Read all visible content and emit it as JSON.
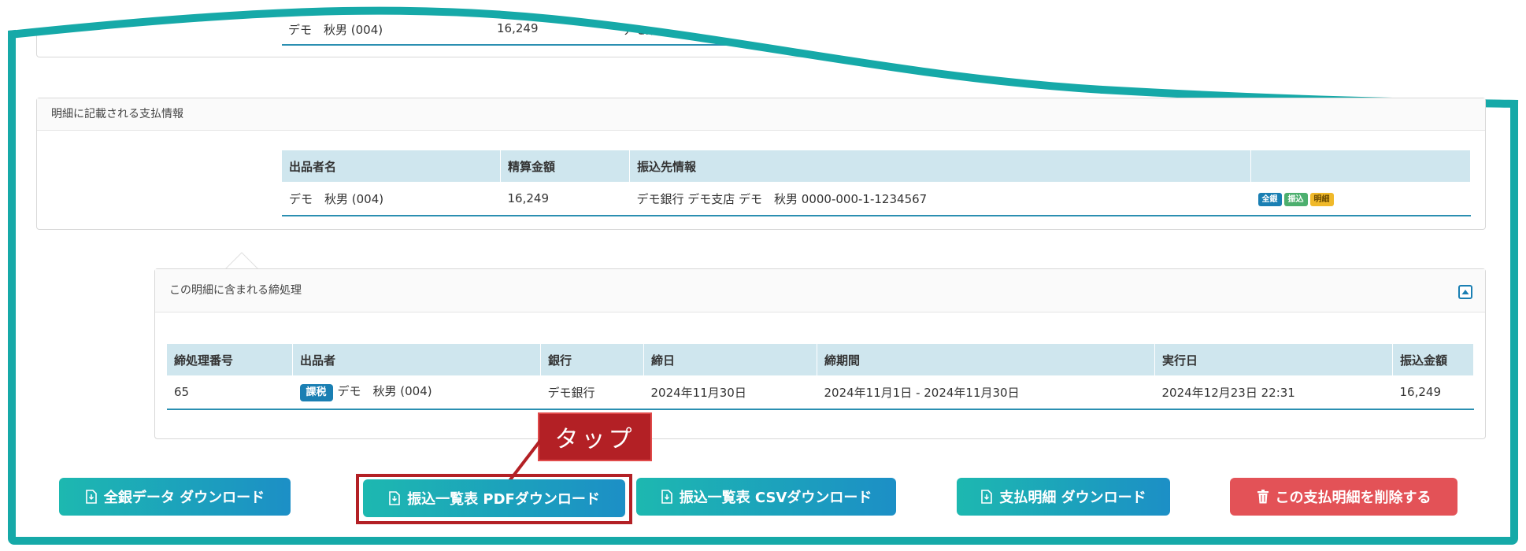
{
  "top_row": {
    "name": "デモ　秋男 (004)",
    "amount": "16,249",
    "bank": "デモ銀行 デモ支店"
  },
  "payment_info": {
    "title": "明細に記載される支払情報",
    "headers": [
      "出品者名",
      "精算金額",
      "振込先情報",
      ""
    ],
    "row": {
      "name": "デモ　秋男 (004)",
      "amount": "16,249",
      "bank": "デモ銀行 デモ支店 デモ　秋男 0000-000-1-1234567",
      "badges": [
        "全銀",
        "振込",
        "明細"
      ]
    }
  },
  "closing": {
    "title": "この明細に含まれる締処理",
    "headers": [
      "締処理番号",
      "出品者",
      "銀行",
      "締日",
      "締期間",
      "実行日",
      "振込金額"
    ],
    "row": {
      "number": "65",
      "tax_badge": "課税",
      "seller": "デモ　秋男 (004)",
      "bank": "デモ銀行",
      "close_date": "2024年11月30日",
      "period": "2024年11月1日 - 2024年11月30日",
      "exec_date": "2024年12月23日 22:31",
      "amount": "16,249"
    }
  },
  "buttons": {
    "zengin": "全銀データ ダウンロード",
    "pdf": "振込一覧表 PDFダウンロード",
    "csv": "振込一覧表 CSVダウンロード",
    "statement": "支払明細 ダウンロード",
    "delete": "この支払明細を削除する"
  },
  "callout": "タップ",
  "colors": {
    "frame": "#16a9a8",
    "header_bg": "#cfe6ee",
    "accent": "#2b8fb1",
    "danger": "#e35257",
    "callout": "#b32025"
  }
}
